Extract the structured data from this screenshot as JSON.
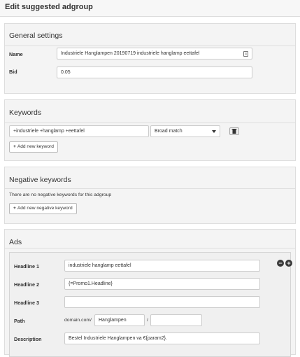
{
  "header": {
    "title": "Edit suggested adgroup"
  },
  "general": {
    "title": "General settings",
    "name_label": "Name",
    "name_value": "Industriele Hanglampen 20190719 industriele hanglamp eettafel",
    "bid_label": "Bid",
    "bid_value": "0.05"
  },
  "keywords": {
    "title": "Keywords",
    "keyword_value": "+industriele +hanglamp +eettafel",
    "match_value": "Broad match",
    "add_label": "Add new keyword"
  },
  "negative": {
    "title": "Negative keywords",
    "empty_text": "There are no negative keywords for this adgroup",
    "add_label": "Add new negative keyword"
  },
  "ads": {
    "title": "Ads",
    "headline1_label": "Headline 1",
    "headline1_value": "industriele hanglamp eettafel",
    "headline2_label": "Headline 2",
    "headline2_value": "{=Promo1.Headline}",
    "headline3_label": "Headline 3",
    "headline3_value": "",
    "path_label": "Path",
    "path_domain": "domain.com/",
    "path1_value": "Hanglampen",
    "path_separator": "/",
    "path2_value": "",
    "description_label": "Description",
    "description_value": "Bestel Industriele Hanglampen va €{param2}."
  },
  "icons": {
    "name_field": "list-icon",
    "delete": "trash-icon",
    "select_arrow": "caret-down-icon",
    "remove_ad": "minus-circle-icon",
    "add_ad": "plus-circle-icon"
  }
}
